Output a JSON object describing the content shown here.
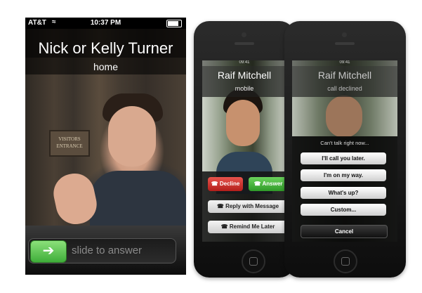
{
  "left_screen": {
    "status": {
      "carrier": "AT&T",
      "time": "10:37 PM"
    },
    "caller_name": "Nick or Kelly Turner",
    "caller_label": "home",
    "slider_text": "slide to answer",
    "sign_text": [
      "VISITORS",
      "ENTRANCE"
    ]
  },
  "phone_incoming": {
    "status_time": "09:41",
    "caller_name": "Raif Mitchell",
    "caller_label": "mobile",
    "decline_label": "Decline",
    "answer_label": "Answer",
    "reply_label": "Reply with Message",
    "remind_label": "Remind Me Later"
  },
  "phone_declined": {
    "status_time": "09:41",
    "caller_name": "Raif Mitchell",
    "caller_label": "call declined",
    "sheet_title": "Can't talk right now...",
    "options": [
      "I'll call you later.",
      "I'm on my way.",
      "What's up?",
      "Custom..."
    ],
    "cancel_label": "Cancel"
  },
  "colors": {
    "answer_green": "#3fae3a",
    "decline_red": "#c8302a"
  }
}
